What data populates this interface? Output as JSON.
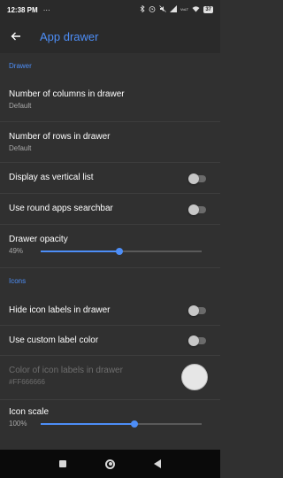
{
  "status_bar": {
    "time": "12:38 PM",
    "dots": "···",
    "icons": [
      "bluetooth-icon",
      "alarm-icon",
      "mute-icon",
      "signal-icon",
      "lte-icon",
      "wifi-icon"
    ],
    "battery": "37"
  },
  "app_bar": {
    "back_icon": "arrow-left-icon",
    "title": "App drawer"
  },
  "sections": {
    "drawer": "Drawer",
    "icons": "Icons"
  },
  "settings": {
    "columns": {
      "label": "Number of columns in drawer",
      "value": "Default"
    },
    "rows": {
      "label": "Number of rows in drawer",
      "value": "Default"
    },
    "vertical_list": {
      "label": "Display as vertical list",
      "enabled": false
    },
    "round_searchbar": {
      "label": "Use round apps searchbar",
      "enabled": false
    },
    "opacity": {
      "label": "Drawer opacity",
      "value": "49%",
      "fraction": 0.49
    },
    "hide_labels": {
      "label": "Hide icon labels in drawer",
      "enabled": false
    },
    "custom_label_color": {
      "label": "Use custom label color",
      "enabled": false
    },
    "label_color": {
      "label": "Color of icon labels in drawer",
      "value": "#FF666666",
      "swatch": "#e6e6e6"
    },
    "icon_scale": {
      "label": "Icon scale",
      "value": "100%",
      "fraction": 0.58
    }
  },
  "colors": {
    "accent": "#4d8ef7",
    "background": "#303030",
    "app_bar": "#2a2a2a"
  }
}
